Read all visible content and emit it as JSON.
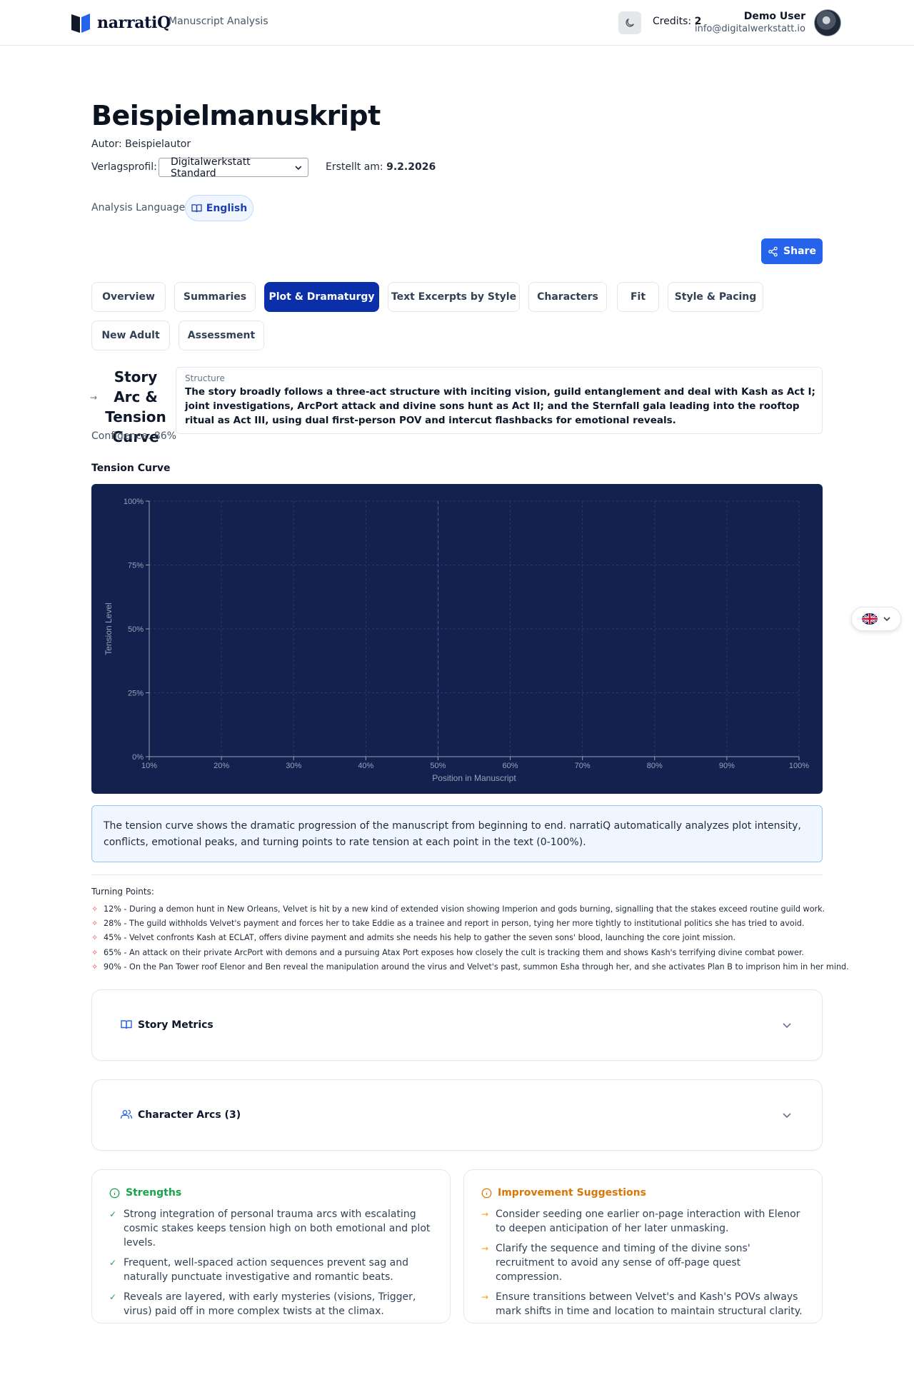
{
  "header": {
    "logo_text": "narratiQ",
    "subtitle": "Manuscript Analysis",
    "credits_label": "Credits:",
    "credits_value": "2",
    "user_name": "Demo User",
    "user_email": "info@digitalwerkstatt.io"
  },
  "manuscript": {
    "title": "Beispielmanuskript",
    "author": "Autor: Beispielautor",
    "profile_label": "Verlagsprofil:",
    "profile_value": "Digitalwerkstatt Standard",
    "created_label": "Erstellt am:",
    "created_value": "9.2.2026",
    "language_label": "Analysis Language:",
    "language_value": "English"
  },
  "share_label": "Share",
  "tabs": [
    {
      "label": "Overview"
    },
    {
      "label": "Summaries"
    },
    {
      "label": "Plot & Dramaturgy",
      "active": true
    },
    {
      "label": "Text Excerpts by Style"
    },
    {
      "label": "Characters"
    },
    {
      "label": "Fit"
    },
    {
      "label": "Style & Pacing"
    },
    {
      "label": "New Adult"
    },
    {
      "label": "Assessment"
    }
  ],
  "story_arc": {
    "title": "Story Arc & Tension Curve",
    "confidence": "Confidence: 86%",
    "structure_label": "Structure",
    "structure_text": "The story broadly follows a three-act structure with inciting vision, guild entanglement and deal with Kash as Act I; joint investigations, ArcPort attack and divine sons hunt as Act II; and the Sternfall gala leading into the rooftop ritual as Act III, using dual first-person POV and intercut flashbacks for emotional reveals."
  },
  "tension_section_label": "Tension Curve",
  "chart_data": {
    "type": "line",
    "xlabel": "Position in Manuscript",
    "ylabel": "Tension Level",
    "x_ticks": [
      "10%",
      "20%",
      "30%",
      "40%",
      "50%",
      "60%",
      "70%",
      "80%",
      "90%",
      "100%"
    ],
    "y_ticks": [
      "0%",
      "25%",
      "50%",
      "75%",
      "100%"
    ],
    "xlim": [
      10,
      100
    ],
    "ylim": [
      0,
      100
    ],
    "series": [],
    "reference_line_x": 50,
    "grid": true,
    "background": "#13214f"
  },
  "tension_info": "The tension curve shows the dramatic progression of the manuscript from beginning to end. narratiQ automatically analyzes plot intensity, conflicts, emotional peaks, and turning points to rate tension at each point in the text (0-100%).",
  "turning_points_label": "Turning Points:",
  "turning_points": [
    "12% - During a demon hunt in New Orleans, Velvet is hit by a new kind of extended vision showing Imperion and gods burning, signalling that the stakes exceed routine guild work.",
    "28% - The guild withholds Velvet's payment and forces her to take Eddie as a trainee and report in person, tying her more tightly to institutional politics she has tried to avoid.",
    "45% - Velvet confronts Kash at ECLAT, offers divine payment and admits she needs his help to gather the seven sons' blood, launching the core joint mission.",
    "65% - An attack on their private ArcPort with demons and a pursuing Atax Port exposes how closely the cult is tracking them and shows Kash's terrifying divine combat power.",
    "90% - On the Pan Tower roof Elenor and Ben reveal the manipulation around the virus and Velvet's past, summon Esha through her, and she activates Plan B to imprison him in her mind."
  ],
  "accordions": {
    "metrics": "Story Metrics",
    "character_arcs": "Character Arcs (3)"
  },
  "strengths": {
    "title": "Strengths",
    "items": [
      "Strong integration of personal trauma arcs with escalating cosmic stakes keeps tension high on both emotional and plot levels.",
      "Frequent, well-spaced action sequences prevent sag and naturally punctuate investigative and romantic beats.",
      "Reveals are layered, with early mysteries (visions, Trigger, virus) paid off in more complex twists at the climax."
    ]
  },
  "improvements": {
    "title": "Improvement Suggestions",
    "items": [
      "Consider seeding one earlier on-page interaction with Elenor to deepen anticipation of her later unmasking.",
      "Clarify the sequence and timing of the divine sons' recruitment to avoid any sense of off-page quest compression.",
      "Ensure transitions between Velvet's and Kash's POVs always mark shifts in time and location to maintain structural clarity."
    ]
  },
  "colors": {
    "primary": "#0b2fa8",
    "share": "#2563eb",
    "strength": "#16a34a",
    "improvement": "#d97706",
    "turning_point": "#ef4444"
  }
}
